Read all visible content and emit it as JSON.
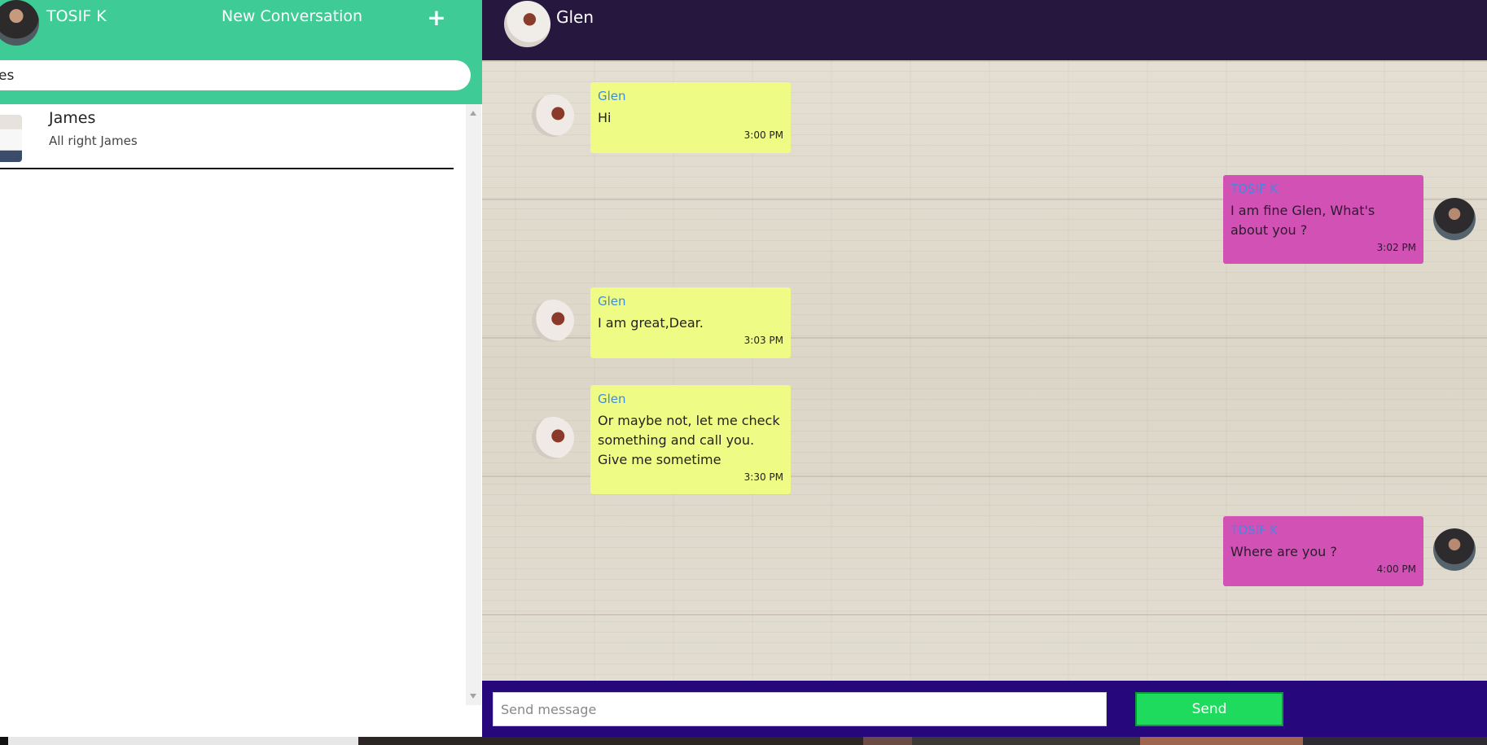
{
  "sidebar": {
    "user_name": "TOSIF K",
    "new_conversation_label": "New Conversation",
    "add_icon": "plus-icon",
    "add_glyph": "+",
    "search": {
      "value": "es",
      "placeholder": ""
    },
    "conversations": [
      {
        "name": "James",
        "preview": "All right James"
      }
    ]
  },
  "chat": {
    "contact_name": "Glen",
    "messages": [
      {
        "direction": "in",
        "sender": "Glen",
        "text": "Hi",
        "time": "3:00 PM"
      },
      {
        "direction": "out",
        "sender": "TOSIF K",
        "text": "I am fine Glen, What's about you ?",
        "time": "3:02 PM"
      },
      {
        "direction": "in",
        "sender": "Glen",
        "text": "I am great,Dear.",
        "time": "3:03 PM"
      },
      {
        "direction": "in",
        "sender": "Glen",
        "text": "Or maybe not, let me check something and call you. Give me sometime",
        "time": "3:30 PM"
      },
      {
        "direction": "out",
        "sender": "TOSIF K",
        "text": "Where are you ?",
        "time": "4:00 PM"
      }
    ],
    "composer": {
      "placeholder": "Send message",
      "value": "",
      "send_label": "Send"
    }
  },
  "colors": {
    "sidebar_header": "#3ecb95",
    "chat_header": "#25173d",
    "composer_bg": "#27077c",
    "incoming_bubble": "#eefb84",
    "outgoing_bubble": "#d251b5",
    "sender_name": "#3e8ae3",
    "send_button": "#1fdb5d"
  }
}
